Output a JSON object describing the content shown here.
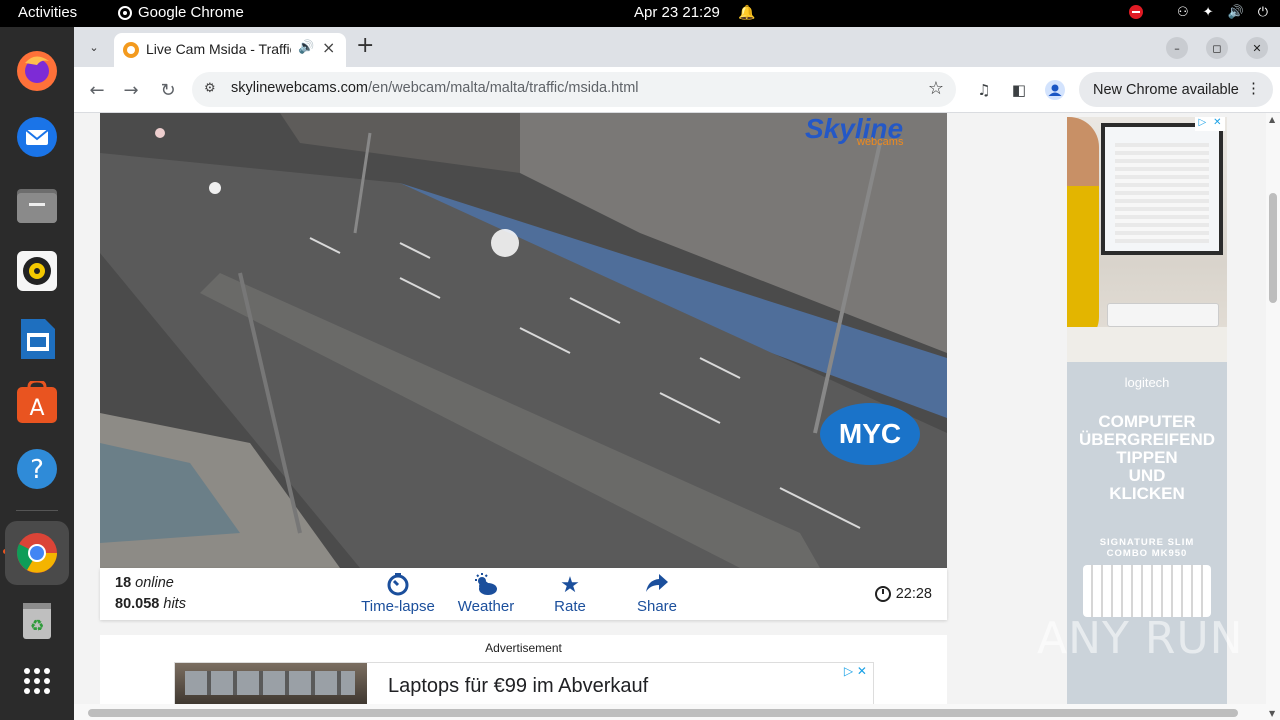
{
  "system": {
    "activities": "Activities",
    "app_name": "Google Chrome",
    "clock": "Apr 23  21:29"
  },
  "browser": {
    "tab_title": "Live Cam Msida - Traffic",
    "url_host": "skylinewebcams.com",
    "url_path": "/en/webcam/malta/malta/traffic/msida.html",
    "update_chip": "New Chrome available"
  },
  "player": {
    "online_count": "18",
    "online_label": "online",
    "hits_count": "80.058",
    "hits_label": "hits",
    "local_time": "22:28",
    "overlay_logo": "MYC",
    "brand_logo": "Skyline",
    "brand_sub": "webcams",
    "actions": [
      {
        "label": "Time-lapse",
        "icon": "timelapse-icon"
      },
      {
        "label": "Weather",
        "icon": "weather-icon"
      },
      {
        "label": "Rate",
        "icon": "star-icon"
      },
      {
        "label": "Share",
        "icon": "share-icon"
      }
    ]
  },
  "ads": {
    "label": "Advertisement",
    "banner_text": "Laptops für €99 im Abverkauf",
    "side_brand": "logitech",
    "side_headline_lines": [
      "COMPUTER",
      "ÜBERGREIFEND",
      "TIPPEN",
      "UND",
      "KLICKEN"
    ],
    "side_product_lines": [
      "SIGNATURE SLIM",
      "COMBO MK950"
    ]
  },
  "watermark": "ANY RUN",
  "colors": {
    "accent_blue": "#1b4f9c",
    "ubuntu_orange": "#e95420",
    "notification_red": "#e01b24"
  }
}
